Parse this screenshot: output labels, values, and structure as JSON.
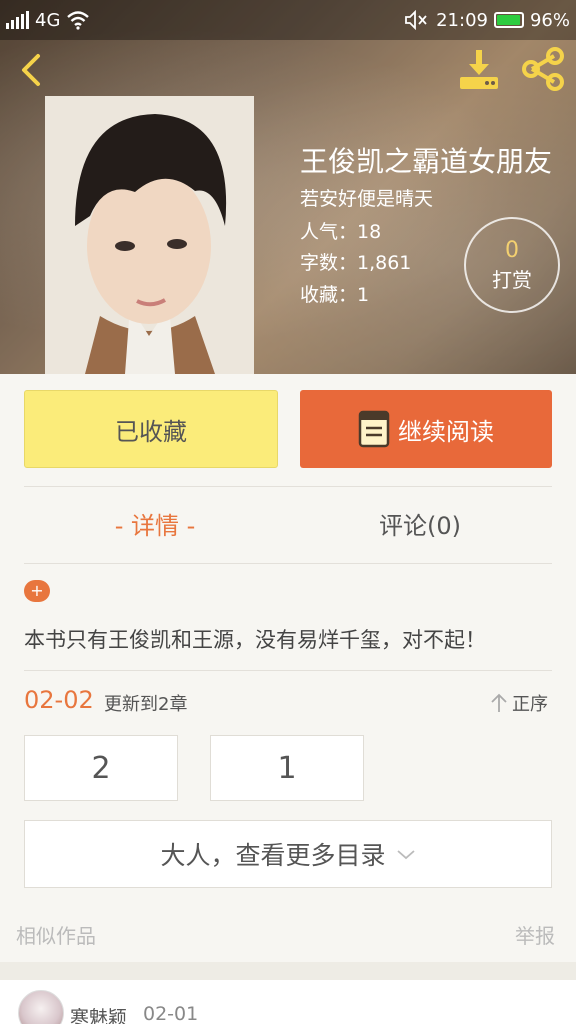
{
  "status": {
    "network": "4G",
    "time": "21:09",
    "battery": "96%",
    "battery_level": 0.96
  },
  "book": {
    "title": "王俊凯之霸道女朋友",
    "author": "若安好便是晴天",
    "popularity": "人气：18",
    "words": "字数：1,861",
    "favorites": "收藏：1",
    "tip_count": "0",
    "tip_label": "打赏"
  },
  "actions": {
    "favorited_label": "已收藏",
    "read_label": "继续阅读"
  },
  "tabs": {
    "detail": "- 详情 -",
    "comments": "评论(0)"
  },
  "synopsis": {
    "badge": "+",
    "text": "本书只有王俊凯和王源，没有易烊千玺，对不起！"
  },
  "update": {
    "date": "02-02",
    "text": "更新到2章",
    "sort_label": "正序"
  },
  "chapters": [
    "2",
    "1"
  ],
  "more_label": "大人，查看更多目录",
  "footer": {
    "similar": "相似作品",
    "report": "举报"
  },
  "comment": {
    "user": "寒魅颖",
    "date": "02-01"
  },
  "colors": {
    "accent": "#e8763e",
    "read_button": "#e8693a",
    "fav_button": "#fbec7a",
    "tip_count": "#f3d070"
  }
}
